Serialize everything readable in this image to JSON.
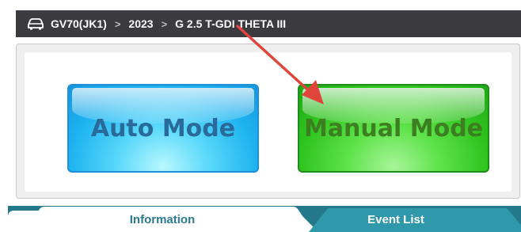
{
  "breadcrumb": {
    "icon": "car-icon",
    "model": "GV70(JK1)",
    "year": "2023",
    "engine": "G 2.5 T-GDI THETA III",
    "separator": ">"
  },
  "mode_panel": {
    "auto_mode_label": "Auto Mode",
    "manual_mode_label": "Manual Mode"
  },
  "annotation": {
    "type": "arrow",
    "color": "#e0453b"
  },
  "tabs": [
    {
      "label": "Information",
      "active": true
    },
    {
      "label": "Event List",
      "active": false
    }
  ],
  "colors": {
    "breadcrumb_bg": "#3b3b3f",
    "auto_button": "#1eb3f0",
    "manual_button": "#2fc41f",
    "tab_bar": "#23788b"
  }
}
